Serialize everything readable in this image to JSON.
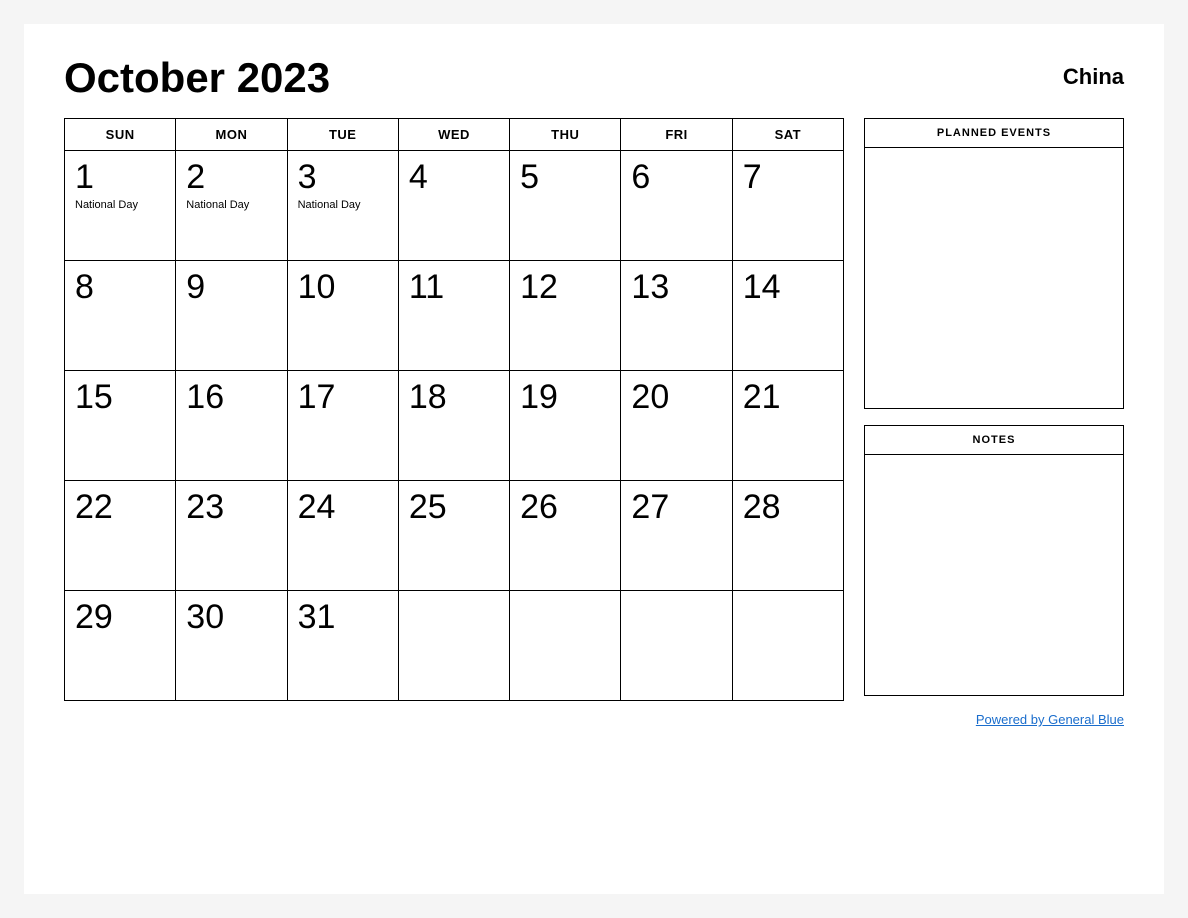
{
  "header": {
    "title": "October 2023",
    "country": "China"
  },
  "calendar": {
    "days_of_week": [
      "SUN",
      "MON",
      "TUE",
      "WED",
      "THU",
      "FRI",
      "SAT"
    ],
    "weeks": [
      [
        {
          "day": "1",
          "event": "National Day"
        },
        {
          "day": "2",
          "event": "National Day"
        },
        {
          "day": "3",
          "event": "National Day"
        },
        {
          "day": "4",
          "event": ""
        },
        {
          "day": "5",
          "event": ""
        },
        {
          "day": "6",
          "event": ""
        },
        {
          "day": "7",
          "event": ""
        }
      ],
      [
        {
          "day": "8",
          "event": ""
        },
        {
          "day": "9",
          "event": ""
        },
        {
          "day": "10",
          "event": ""
        },
        {
          "day": "11",
          "event": ""
        },
        {
          "day": "12",
          "event": ""
        },
        {
          "day": "13",
          "event": ""
        },
        {
          "day": "14",
          "event": ""
        }
      ],
      [
        {
          "day": "15",
          "event": ""
        },
        {
          "day": "16",
          "event": ""
        },
        {
          "day": "17",
          "event": ""
        },
        {
          "day": "18",
          "event": ""
        },
        {
          "day": "19",
          "event": ""
        },
        {
          "day": "20",
          "event": ""
        },
        {
          "day": "21",
          "event": ""
        }
      ],
      [
        {
          "day": "22",
          "event": ""
        },
        {
          "day": "23",
          "event": ""
        },
        {
          "day": "24",
          "event": ""
        },
        {
          "day": "25",
          "event": ""
        },
        {
          "day": "26",
          "event": ""
        },
        {
          "day": "27",
          "event": ""
        },
        {
          "day": "28",
          "event": ""
        }
      ],
      [
        {
          "day": "29",
          "event": ""
        },
        {
          "day": "30",
          "event": ""
        },
        {
          "day": "31",
          "event": ""
        },
        {
          "day": "",
          "event": ""
        },
        {
          "day": "",
          "event": ""
        },
        {
          "day": "",
          "event": ""
        },
        {
          "day": "",
          "event": ""
        }
      ]
    ]
  },
  "sidebar": {
    "planned_events_label": "PLANNED EVENTS",
    "notes_label": "NOTES"
  },
  "footer": {
    "powered_by": "Powered by General Blue",
    "link": "#"
  }
}
